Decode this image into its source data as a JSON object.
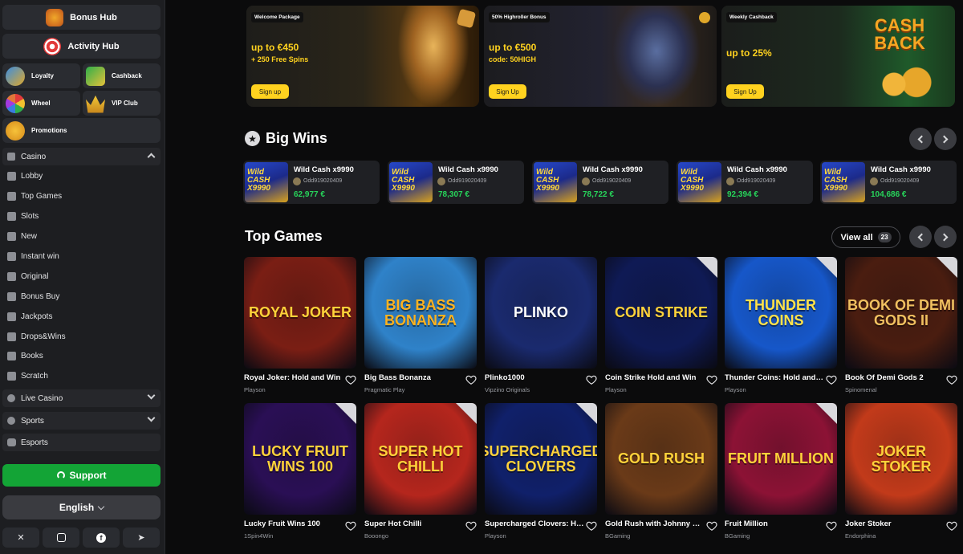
{
  "sidebar": {
    "bonus_hub": "Bonus Hub",
    "activity_hub": "Activity Hub",
    "tiles": [
      {
        "label": "Loyalty",
        "icon": "loyalty-icon"
      },
      {
        "label": "Cashback",
        "icon": "cashback-icon"
      },
      {
        "label": "Wheel",
        "icon": "wheel-icon"
      },
      {
        "label": "VIP Club",
        "icon": "crown-icon"
      },
      {
        "label": "Promotions",
        "icon": "percent-icon"
      }
    ],
    "casino": "Casino",
    "items": [
      "Lobby",
      "Top Games",
      "Slots",
      "New",
      "Instant win",
      "Original",
      "Bonus Buy",
      "Jackpots",
      "Drops&Wins",
      "Books",
      "Scratch"
    ],
    "live_casino": "Live Casino",
    "sports": "Sports",
    "esports": "Esports",
    "support": "Support",
    "language": "English",
    "socials": [
      "x-icon",
      "instagram-icon",
      "facebook-icon",
      "telegram-icon"
    ]
  },
  "promos": [
    {
      "badge": "Welcome Package",
      "big": "up to €450",
      "small": "+ 250 Free Spins",
      "button": "Sign up"
    },
    {
      "badge": "50% Highroller Bonus",
      "big": "up to €500",
      "small": "code: 50HIGH",
      "button": "Sign Up"
    },
    {
      "badge": "Weekly Cashback",
      "big": "up to 25%",
      "small": "",
      "button": "Sign Up",
      "art_text": "CASH BACK"
    }
  ],
  "big_wins": {
    "title": "Big Wins",
    "entries": [
      {
        "game": "Wild Cash x9990",
        "user": "Odd919020409",
        "amount": "62,977 €"
      },
      {
        "game": "Wild Cash x9990",
        "user": "Odd919020409",
        "amount": "78,307 €"
      },
      {
        "game": "Wild Cash x9990",
        "user": "Odd919020409",
        "amount": "78,722 €"
      },
      {
        "game": "Wild Cash x9990",
        "user": "Odd919020409",
        "amount": "92,394 €"
      },
      {
        "game": "Wild Cash x9990",
        "user": "Odd919020409",
        "amount": "104,686 €"
      }
    ],
    "thumb_text": "Wild CASH X9990"
  },
  "top_games": {
    "title": "Top Games",
    "view_all": "View all",
    "count": "23",
    "games": [
      {
        "name": "Royal Joker: Hold and Win",
        "provider": "Playson",
        "art": "ROYAL JOKER",
        "bg": "#7a1e14"
      },
      {
        "name": "Big Bass Bonanza",
        "provider": "Pragmatic Play",
        "art": "BIG BASS BONANZA",
        "bg": "#2f82c9"
      },
      {
        "name": "Plinko1000",
        "provider": "Vipzino Originals",
        "art": "PLINKO",
        "bg": "#1a2a6e"
      },
      {
        "name": "Coin Strike Hold and Win",
        "provider": "Playson",
        "art": "COIN STRIKE",
        "bg": "#0f1a55"
      },
      {
        "name": "Thunder Coins: Hold and Win",
        "provider": "Playson",
        "art": "THUNDER COINS",
        "bg": "#1657c9"
      },
      {
        "name": "Book Of Demi Gods 2",
        "provider": "Spinomenal",
        "art": "BOOK OF DEMI GODS II",
        "bg": "#4a1d10"
      },
      {
        "name": "Lucky Fruit Wins 100",
        "provider": "1Spin4Win",
        "art": "LUCKY FRUIT WINS 100",
        "bg": "#2a0f55"
      },
      {
        "name": "Super Hot Chilli",
        "provider": "Booongo",
        "art": "SUPER HOT CHILLI",
        "bg": "#b5261d"
      },
      {
        "name": "Supercharged Clovers: Hold and Win",
        "provider": "Playson",
        "art": "SUPERCHARGED CLOVERS",
        "bg": "#10206a"
      },
      {
        "name": "Gold Rush with Johnny Cash",
        "provider": "BGaming",
        "art": "GOLD RUSH",
        "bg": "#6a3a18"
      },
      {
        "name": "Fruit Million",
        "provider": "BGaming",
        "art": "FRUIT MILLION",
        "bg": "#8c1235"
      },
      {
        "name": "Joker Stoker",
        "provider": "Endorphina",
        "art": "JOKER STOKER",
        "bg": "#c23a1a"
      }
    ]
  }
}
